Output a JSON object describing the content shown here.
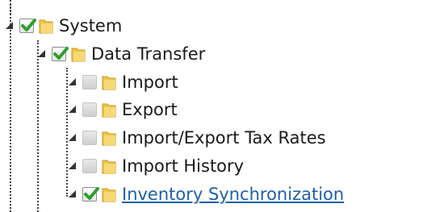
{
  "tree": {
    "root": {
      "label": "System",
      "checked": true,
      "expanded": true
    },
    "child": {
      "label": "Data Transfer",
      "checked": true,
      "expanded": true
    },
    "items": [
      {
        "label": "Import",
        "checked": false,
        "link": false
      },
      {
        "label": "Export",
        "checked": false,
        "link": false
      },
      {
        "label": "Import/Export Tax Rates",
        "checked": false,
        "link": false
      },
      {
        "label": "Import History",
        "checked": false,
        "link": false
      },
      {
        "label": "Inventory Synchronization",
        "checked": true,
        "link": true
      }
    ]
  },
  "colors": {
    "checkmark": "#2e9e2e",
    "link": "#1f5fa8",
    "folder": "#f0c44a",
    "guide_line": "#444444"
  },
  "icons": {
    "toggle": "tree-expand-arrow-icon",
    "folder": "folder-icon",
    "check": "checkmark-icon"
  }
}
